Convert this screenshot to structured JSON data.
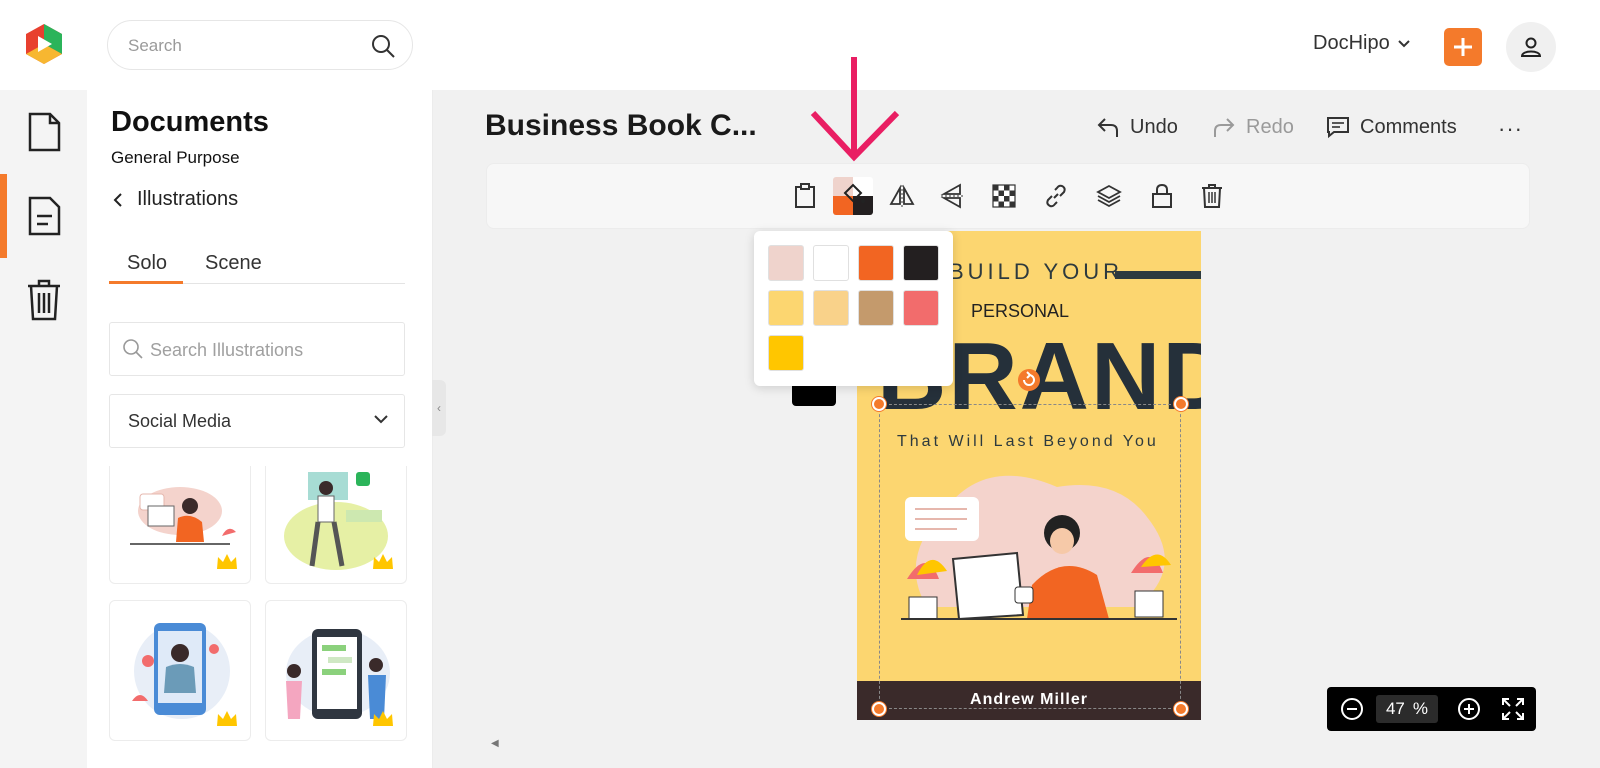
{
  "header": {
    "search_placeholder": "Search",
    "account_name": "DocHipo",
    "brand_color": "#f47a2b"
  },
  "rail": {
    "items": [
      {
        "name": "document-icon"
      },
      {
        "name": "template-icon"
      },
      {
        "name": "trash-icon"
      }
    ]
  },
  "panel": {
    "title": "Documents",
    "subtitle": "General Purpose",
    "back_label": "Illustrations",
    "tabs": [
      "Solo",
      "Scene"
    ],
    "active_tab": "Solo",
    "search_placeholder": "Search Illustrations",
    "category": "Social Media"
  },
  "editor": {
    "doc_title": "Business Book C...",
    "undo_label": "Undo",
    "redo_label": "Redo",
    "comments_label": "Comments",
    "more_label": "···",
    "toolbar_icons": [
      "clipboard-icon",
      "fill-color-icon",
      "flip-horizontal-icon",
      "flip-vertical-icon",
      "transparency-icon",
      "link-icon",
      "layers-icon",
      "lock-icon",
      "delete-icon"
    ],
    "palette": [
      "#efd3cc",
      "#ffffff",
      "#f26522",
      "#231f20",
      "#fcd670",
      "#f9d28a",
      "#c49a6c",
      "#f26c6c",
      "#ffc600"
    ]
  },
  "cover": {
    "build_your": "BUILD YOUR",
    "personal": "PERSONAL",
    "brand": "BRAND",
    "tagline": "That Will Last Beyond You",
    "author": "Andrew Miller"
  },
  "zoom": {
    "value": "47",
    "unit": "%"
  }
}
